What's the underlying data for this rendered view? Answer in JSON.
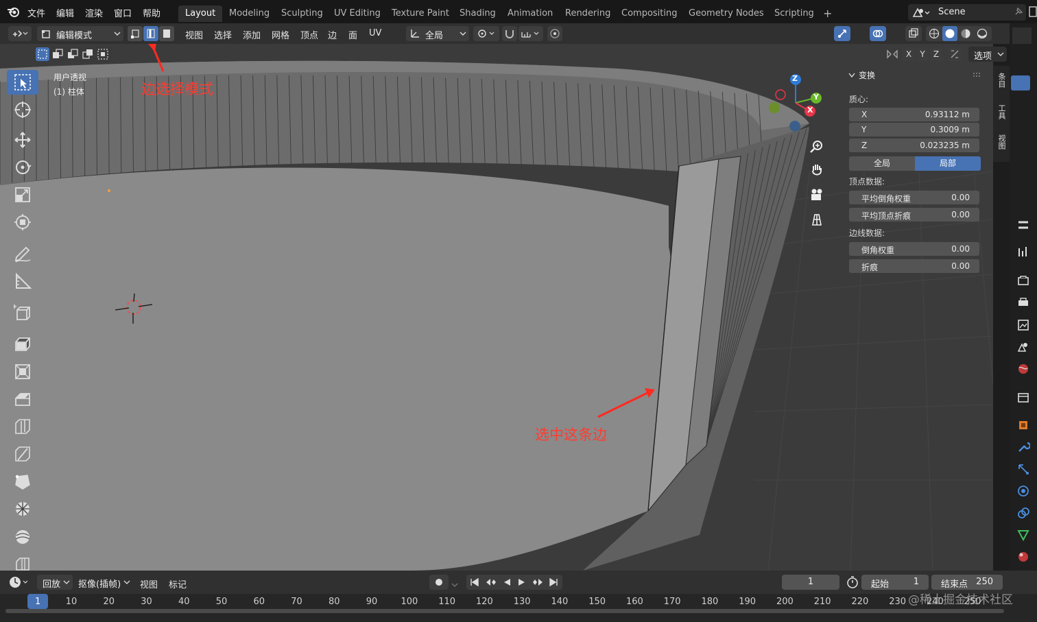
{
  "menubar": {
    "items": [
      "文件",
      "编辑",
      "渲染",
      "窗口",
      "帮助"
    ],
    "workspaces": [
      "Layout",
      "Modeling",
      "Sculpting",
      "UV Editing",
      "Texture Paint",
      "Shading",
      "Animation",
      "Rendering",
      "Compositing",
      "Geometry Nodes",
      "Scripting"
    ],
    "active_workspace": "Layout",
    "add_tab": "+",
    "scene_name": "Scene"
  },
  "header": {
    "mode": "编辑模式",
    "menus": [
      "视图",
      "选择",
      "添加",
      "网格",
      "顶点",
      "边",
      "面",
      "UV"
    ],
    "transform_orientation": "全局",
    "axes": [
      "X",
      "Y",
      "Z"
    ],
    "options": "选项"
  },
  "viewport": {
    "view_name": "用户透视",
    "object_name": "(1) 柱体",
    "annotations": {
      "edge_select_mode": "边选择模式",
      "select_this_edge": "选中这条边"
    },
    "gizmo": {
      "x": "X",
      "y": "Y",
      "z": "Z"
    }
  },
  "npanel": {
    "title": "变换",
    "median_label": "质心:",
    "median": [
      {
        "axis": "X",
        "value": "0.93112 m"
      },
      {
        "axis": "Y",
        "value": "0.3009 m"
      },
      {
        "axis": "Z",
        "value": "0.023235 m"
      }
    ],
    "toggle": {
      "global": "全局",
      "local": "局部",
      "active": "local"
    },
    "vertex_data_label": "顶点数据:",
    "vertex_data": [
      {
        "label": "平均倒角权重",
        "value": "0.00"
      },
      {
        "label": "平均顶点折痕",
        "value": "0.00"
      }
    ],
    "edge_data_label": "边线数据:",
    "edge_data": [
      {
        "label": "倒角权重",
        "value": "0.00"
      },
      {
        "label": "折痕",
        "value": "0.00"
      }
    ],
    "side_tabs": [
      "条目",
      "工具",
      "视图"
    ]
  },
  "timeline": {
    "menus": [
      "回放",
      "抠像(插帧)",
      "视图",
      "标记"
    ],
    "current_frame": "1",
    "start_label": "起始",
    "start": "1",
    "end_label": "结束点",
    "end": "250",
    "ticks": [
      "1",
      "10",
      "20",
      "30",
      "40",
      "50",
      "60",
      "70",
      "80",
      "90",
      "100",
      "110",
      "120",
      "130",
      "140",
      "150",
      "160",
      "170",
      "180",
      "190",
      "200",
      "210",
      "220",
      "230",
      "240",
      "250"
    ],
    "watermark": "@稀土掘金技术社区"
  }
}
